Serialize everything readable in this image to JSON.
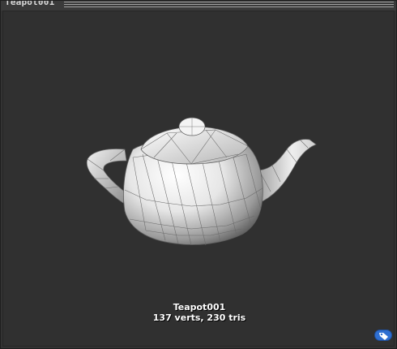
{
  "window": {
    "title": "Teapot001"
  },
  "viewport": {
    "object_name": "Teapot001",
    "stats": "137 verts, 230 tris",
    "background_color": "#303030",
    "model_icon": "teapot-wireframe",
    "tag_icon": "tag-icon",
    "tag_color": "#2f6fd1"
  }
}
